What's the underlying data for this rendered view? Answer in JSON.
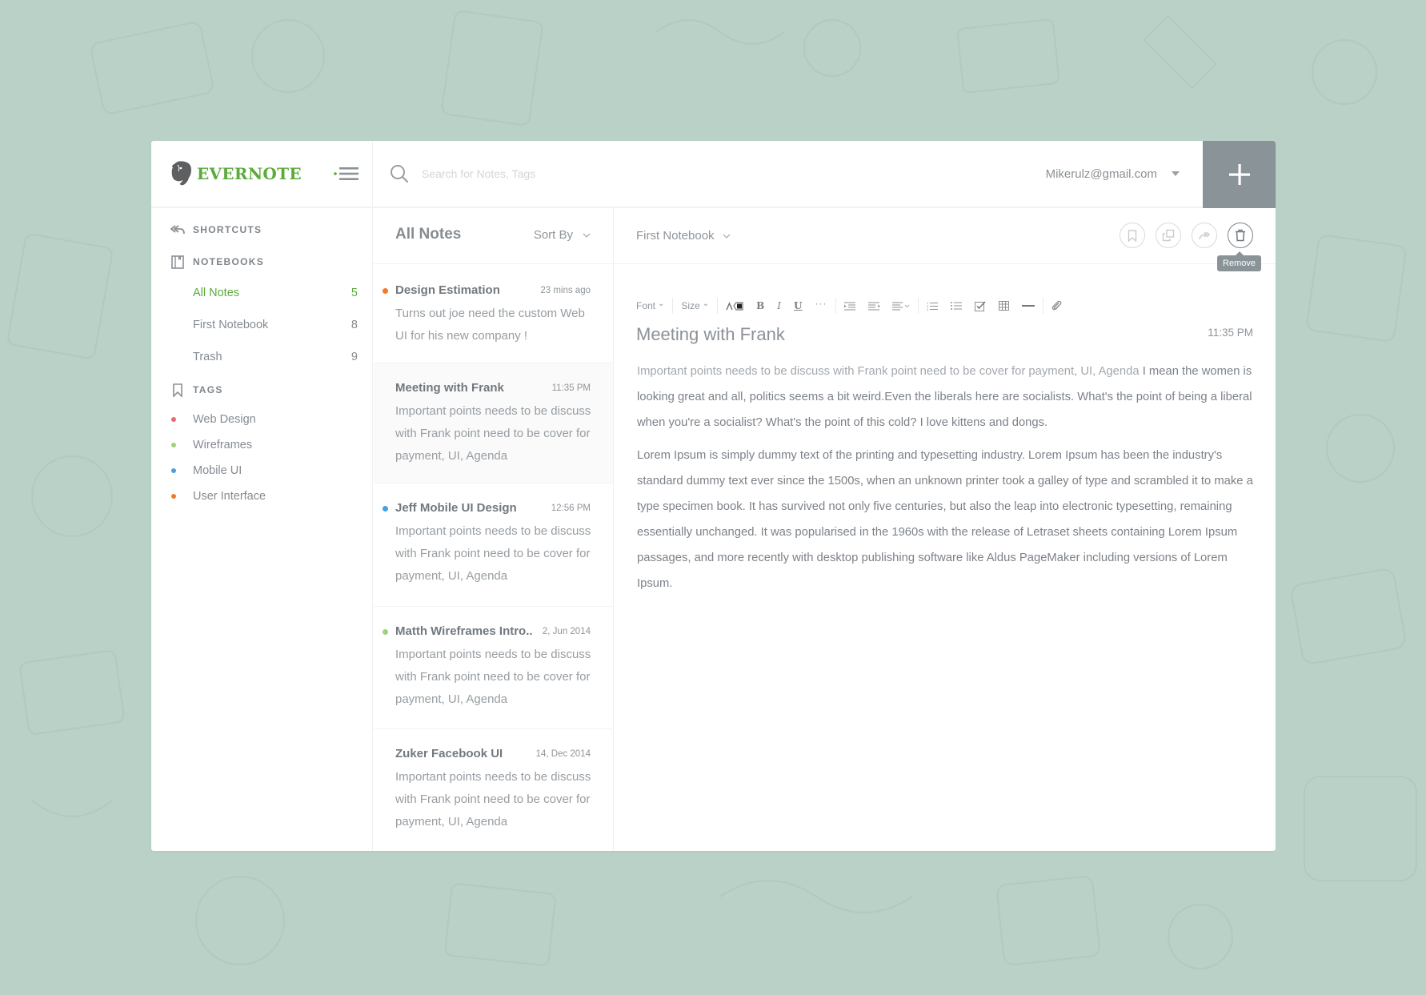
{
  "app": {
    "brand": "EVERNOTE",
    "accent_color": "#5bab3b"
  },
  "header": {
    "search_placeholder": "Search for Notes, Tags",
    "account_email": "Mikerulz@gmail.com",
    "add_label": "+"
  },
  "sidebar": {
    "shortcuts_label": "SHORTCUTS",
    "notebooks_label": "NOTEBOOKS",
    "notebooks": [
      {
        "label": "All Notes",
        "count": "5",
        "active": true
      },
      {
        "label": "First Notebook",
        "count": "8",
        "active": false
      },
      {
        "label": "Trash",
        "count": "9",
        "active": false
      }
    ],
    "tags_label": "TAGS",
    "tags": [
      {
        "label": "Web Design",
        "color": "#ea6a6a"
      },
      {
        "label": "Wireframes",
        "color": "#9fd27a"
      },
      {
        "label": "Mobile UI",
        "color": "#4a9fe0"
      },
      {
        "label": "User Interface",
        "color": "#f07a2c"
      }
    ]
  },
  "notelist": {
    "title": "All Notes",
    "sort_label": "Sort By",
    "notes": [
      {
        "title": "Design Estimation",
        "date": "23 mins ago",
        "snippet": "Turns out joe need the custom Web UI for his new company !",
        "dot": "#f07a2c",
        "selected": false
      },
      {
        "title": "Meeting with Frank",
        "date": "11:35 PM",
        "snippet": "Important points needs to be discuss with Frank point need to be cover for payment, UI, Agenda",
        "dot": null,
        "selected": true
      },
      {
        "title": "Jeff Mobile UI Design",
        "date": "12:56 PM",
        "snippet": "Important points needs to be discuss with Frank point need to be cover for payment, UI, Agenda",
        "dot": "#4a9fe0",
        "selected": false
      },
      {
        "title": "Matth Wireframes Intro..",
        "date": "2, Jun 2014",
        "snippet": "Important points needs to be discuss with Frank point need to be cover for payment, UI, Agenda",
        "dot": "#9fd27a",
        "selected": false
      },
      {
        "title": "Zuker Facebook UI",
        "date": "14, Dec 2014",
        "snippet": "Important points needs to be discuss with Frank point need to be cover for payment, UI, Agenda",
        "dot": null,
        "selected": false
      }
    ]
  },
  "editor": {
    "notebook": "First Notebook",
    "actions": [
      {
        "name": "bookmark",
        "icon": "bookmark-icon"
      },
      {
        "name": "duplicate",
        "icon": "copy-icon"
      },
      {
        "name": "share",
        "icon": "share-icon"
      },
      {
        "name": "remove",
        "icon": "trash-icon"
      }
    ],
    "tooltip": "Remove",
    "toolbar": {
      "font": "Font",
      "size": "Size"
    },
    "title": "Meeting with Frank",
    "time": "11:35 PM",
    "body": {
      "highlight": "Important points needs to be discuss with Frank point need to be cover for payment, UI, Agenda",
      "p1_rest": " I mean the women is looking great and all, politics seems a bit weird.Even the liberals here are socialists. What's the point of being a liberal when you're a socialist? What's the point of this cold? I love kittens and dongs.",
      "p2": "Lorem Ipsum is simply dummy text of the printing and typesetting industry. Lorem Ipsum has been the industry's standard dummy text ever since the 1500s, when an unknown printer took a galley of type and scrambled it to make a type specimen book. It has survived not only five centuries, but also the leap into electronic typesetting, remaining essentially unchanged. It was popularised in the 1960s with the release of Letraset sheets containing Lorem Ipsum passages, and more recently with desktop publishing software like Aldus PageMaker including versions of Lorem Ipsum."
    }
  }
}
